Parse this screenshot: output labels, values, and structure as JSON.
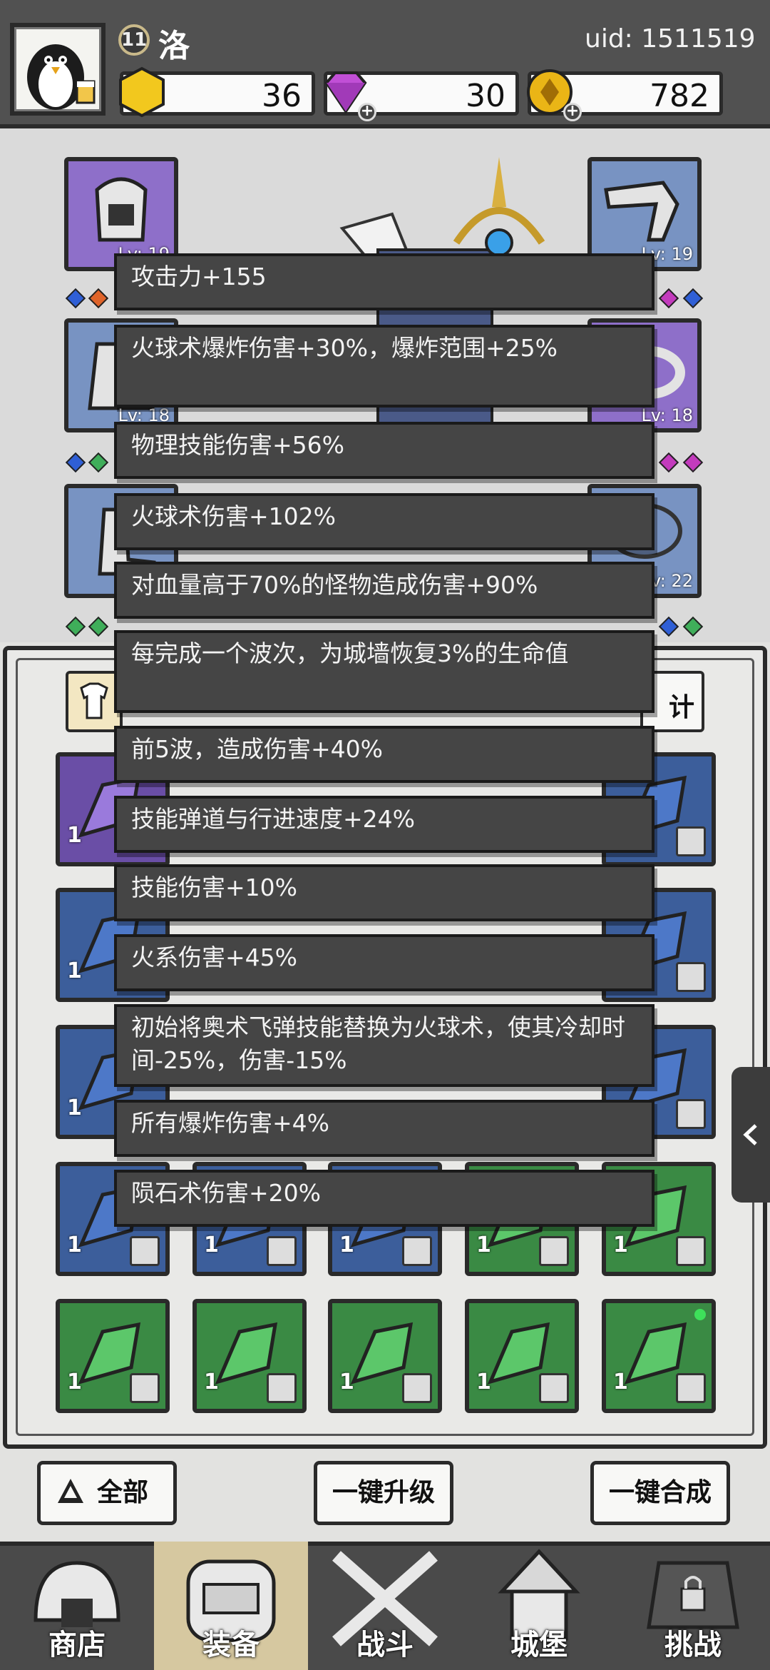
{
  "header": {
    "player_level": "11",
    "player_name": "洛",
    "uid": "uid: 1511519",
    "resources": [
      {
        "icon": "gold-hexagon-icon",
        "value": "36"
      },
      {
        "icon": "purple-diamond-icon",
        "value": "30"
      },
      {
        "icon": "gold-coin-icon",
        "value": "782"
      }
    ]
  },
  "equipment": {
    "left_slots": [
      {
        "level": "Lv: 19"
      },
      {
        "level": "Lv: 18"
      },
      {
        "level": ""
      }
    ],
    "right_slots": [
      {
        "level": "Lv: 19"
      },
      {
        "level": "Lv: 18"
      },
      {
        "level": "Lv: 22"
      }
    ]
  },
  "panel": {
    "right_tab_label": "计"
  },
  "tooltip": {
    "lines": [
      "攻击力+155",
      "火球术爆炸伤害+30%，爆炸范围+25%",
      "物理技能伤害+56%",
      "火球术伤害+102%",
      "对血量高于70%的怪物造成伤害+90%",
      "每完成一个波次，为城墙恢复3%的生命值",
      "前5波，造成伤害+40%",
      "技能弹道与行进速度+24%",
      "技能伤害+10%",
      "火系伤害+45%",
      "初始将奥术飞弹技能替换为火球术，使其冷却时间-25%，伤害-15%",
      "所有爆炸伤害+4%",
      "陨石术伤害+20%"
    ]
  },
  "inventory_count": "1",
  "buttons": {
    "filter": "全部",
    "upgrade_all": "一键升级",
    "merge_all": "一键合成"
  },
  "nav": [
    "商店",
    "装备",
    "战斗",
    "城堡",
    "挑战"
  ]
}
